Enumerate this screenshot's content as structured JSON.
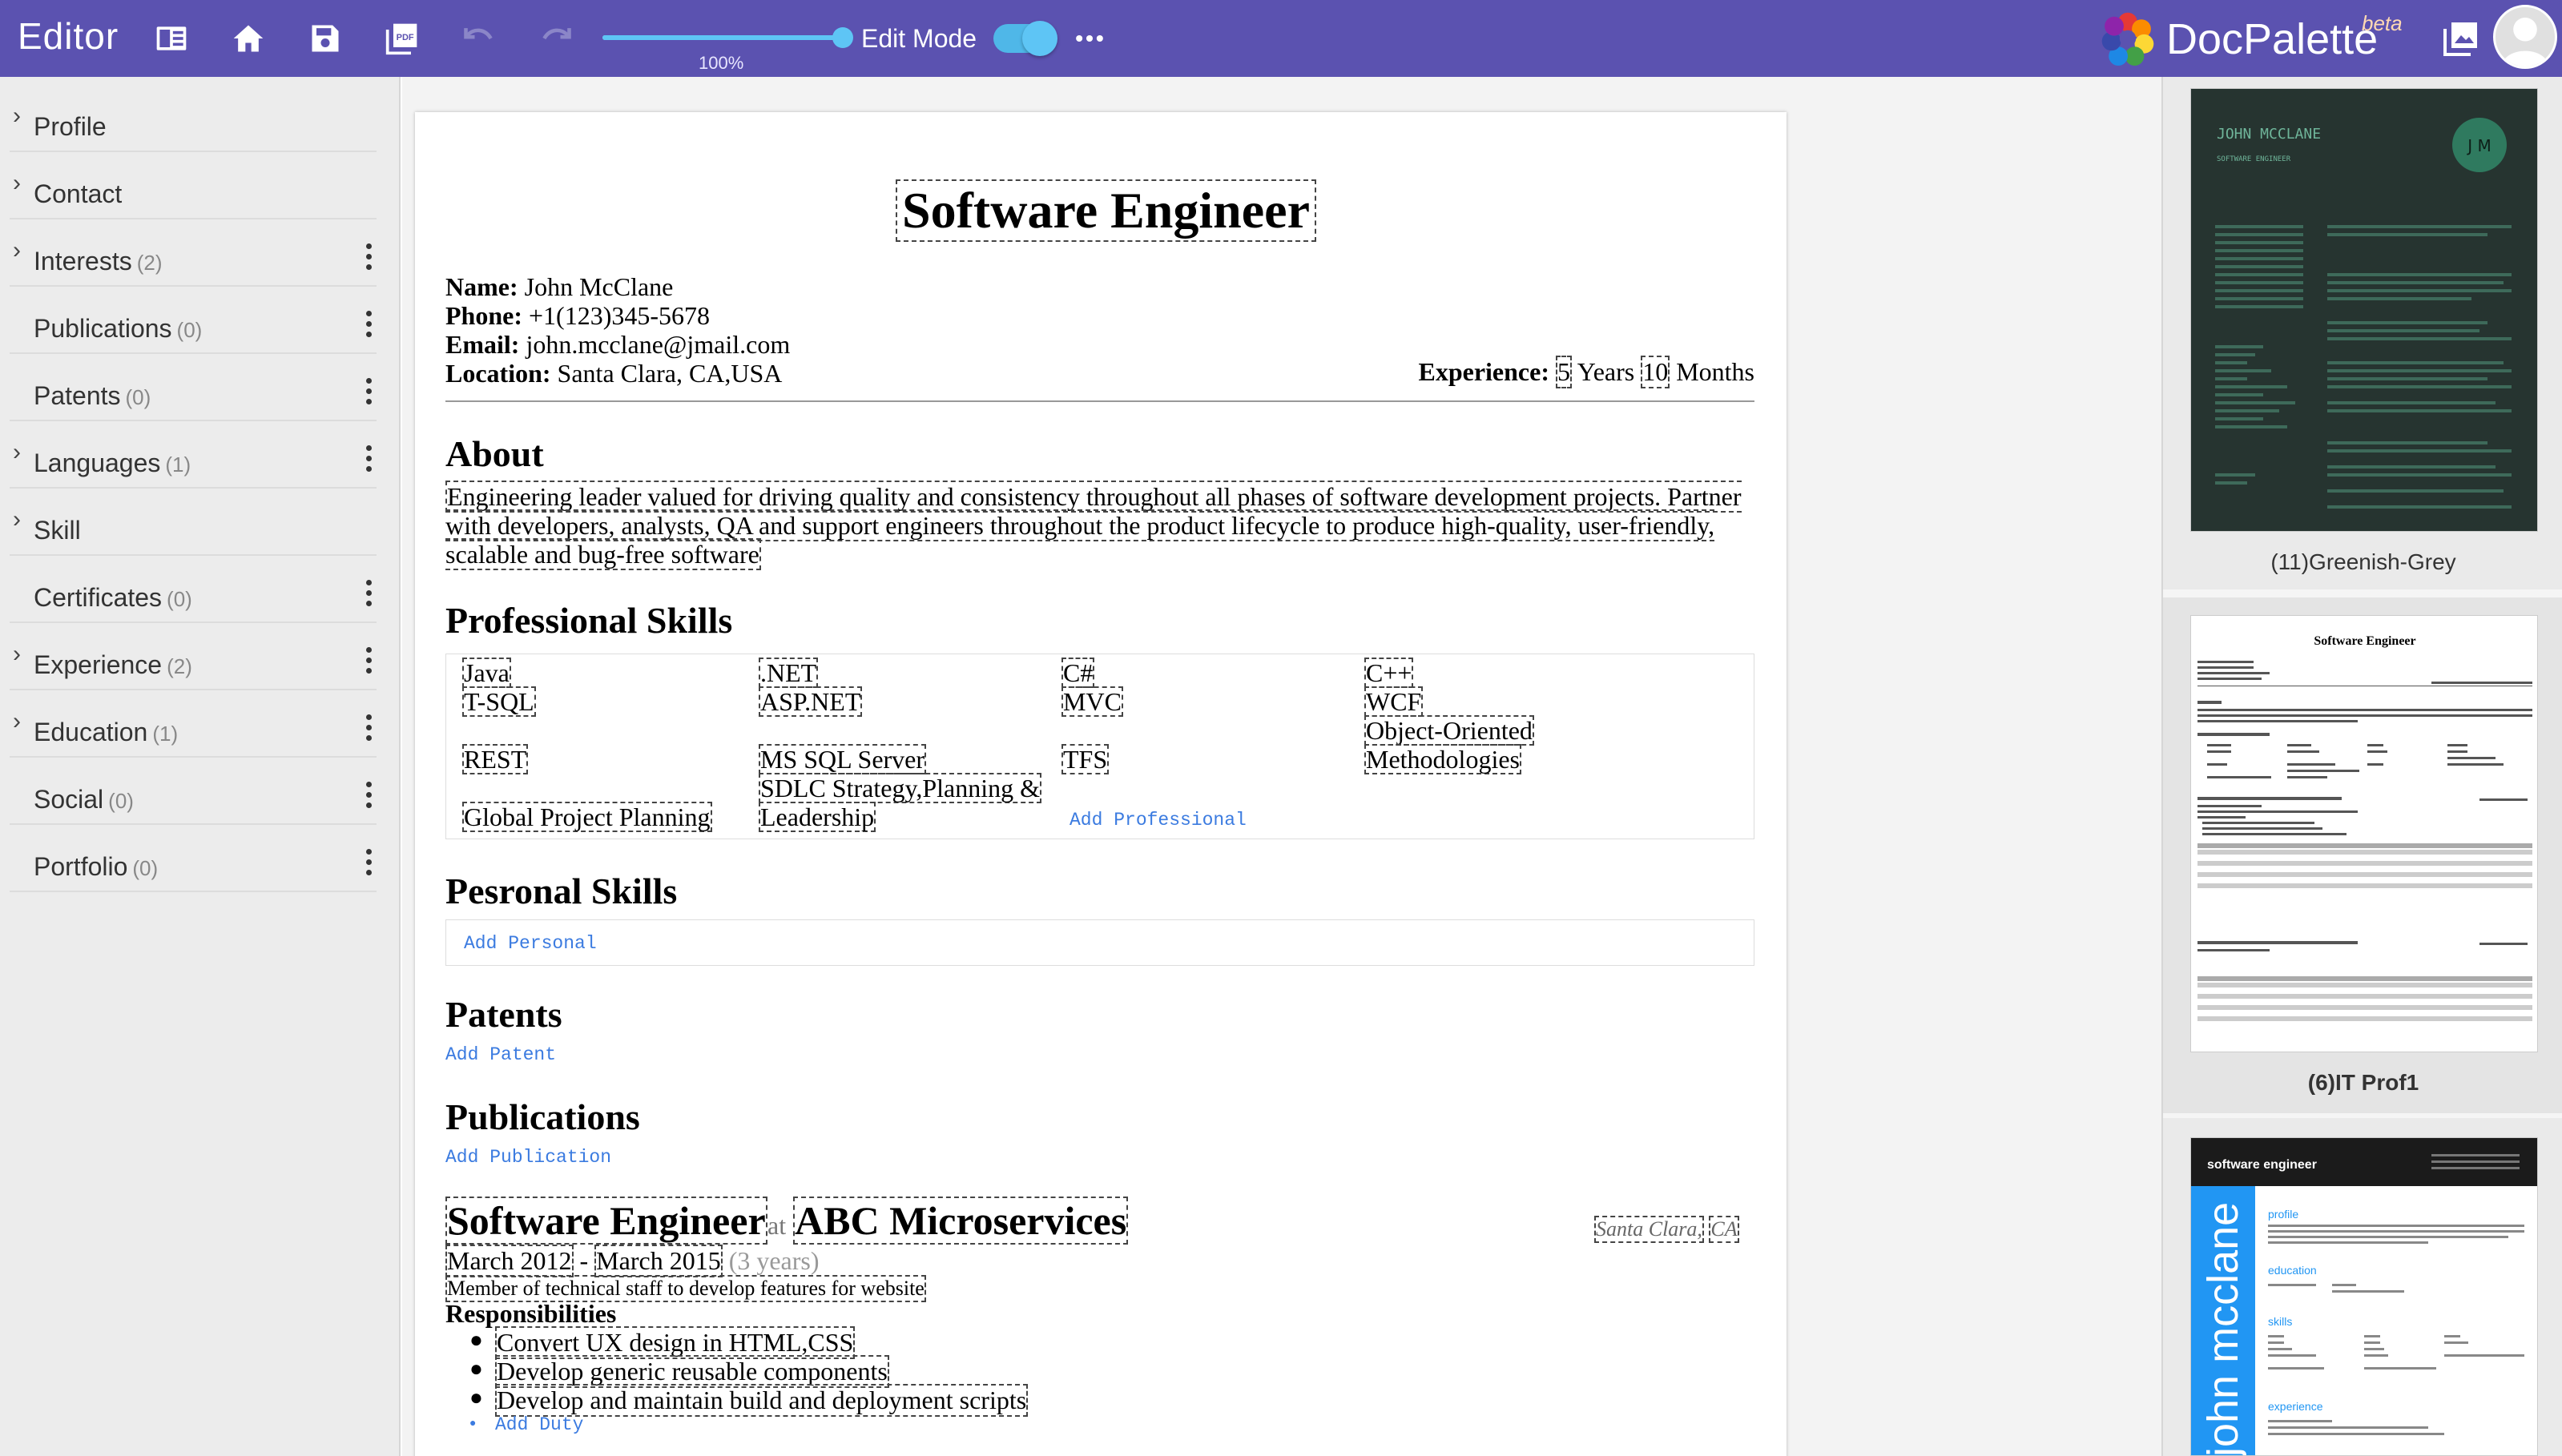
{
  "app": {
    "title": "Editor",
    "zoom_label": "100%",
    "zoom_value": 1.0,
    "edit_mode_label": "Edit Mode",
    "edit_mode_on": true,
    "brand_name": "DocPalette",
    "brand_beta": "beta",
    "accent_color": "#5b52b0",
    "toggle_color": "#5ec5f5",
    "toolbar_icons": [
      "sidebar-toggle-icon",
      "home-icon",
      "save-icon",
      "pdf-icon",
      "undo-icon",
      "redo-icon",
      "more-icon"
    ]
  },
  "sidebar": {
    "items": [
      {
        "label": "Profile",
        "count": "",
        "expandable": true,
        "menu": false
      },
      {
        "label": "Contact",
        "count": "",
        "expandable": true,
        "menu": false
      },
      {
        "label": "Interests",
        "count": "(2)",
        "expandable": true,
        "menu": true
      },
      {
        "label": "Publications",
        "count": "(0)",
        "expandable": false,
        "menu": true
      },
      {
        "label": "Patents",
        "count": "(0)",
        "expandable": false,
        "menu": true
      },
      {
        "label": "Languages",
        "count": "(1)",
        "expandable": true,
        "menu": true
      },
      {
        "label": "Skill",
        "count": "",
        "expandable": true,
        "menu": false
      },
      {
        "label": "Certificates",
        "count": "(0)",
        "expandable": false,
        "menu": true
      },
      {
        "label": "Experience",
        "count": "(2)",
        "expandable": true,
        "menu": true
      },
      {
        "label": "Education",
        "count": "(1)",
        "expandable": true,
        "menu": true
      },
      {
        "label": "Social",
        "count": "(0)",
        "expandable": false,
        "menu": true
      },
      {
        "label": "Portfolio",
        "count": "(0)",
        "expandable": false,
        "menu": true
      }
    ]
  },
  "doc": {
    "title": "Software Engineer",
    "name_label": "Name:",
    "name": "John McClane",
    "phone_label": "Phone:",
    "phone": "+1(123)345-5678",
    "email_label": "Email:",
    "email": "john.mcclane@jmail.com",
    "location_label": "Location:",
    "location": "Santa Clara, CA,USA",
    "experience_label": "Experience:",
    "exp_years": "5",
    "years_word": "Years",
    "exp_months": "10",
    "months_word": "Months",
    "about_heading": "About",
    "about_text": "Engineering leader valued for driving quality and consistency throughout all phases of software development projects. Partner with developers, analysts, QA and support engineers throughout the product lifecycle to produce high-quality, user-friendly, scalable and bug-free software",
    "pro_skills_heading": "Professional Skills",
    "skills": {
      "col1": [
        "Java",
        "T-SQL",
        "REST",
        "Global Project Planning"
      ],
      "col2": [
        ".NET",
        "ASP.NET",
        "MS SQL Server",
        "SDLC Strategy,Planning &",
        "Leadership"
      ],
      "col3": [
        "C#",
        "MVC",
        "TFS"
      ],
      "col4": [
        "C++",
        "WCF",
        "Object-Oriented",
        "Methodologies"
      ]
    },
    "add_professional": "Add Professional",
    "personal_heading": "Pesronal Skills",
    "add_personal": "Add Personal",
    "patents_heading": "Patents",
    "add_patent": "Add Patent",
    "publications_heading": "Publications",
    "add_publication": "Add Publication",
    "job": {
      "title": "Software Engineer",
      "at": "at",
      "company": "ABC Microservices",
      "city": "Santa Clara,",
      "state": "CA",
      "start": "March 2012",
      "sep": "-",
      "end": "March 2015",
      "duration": "(3 years)",
      "description": "Member of technical staff to develop features for website",
      "resp_heading": "Responsibilities",
      "duties": [
        "Convert UX design in HTML,CSS",
        "Develop generic reusable components",
        "Develop and maintain build and deployment scripts"
      ],
      "add_duty": "Add Duty"
    }
  },
  "templates": [
    {
      "label": "(11)Greenish-Grey",
      "name": "JOHN MCCLANE",
      "subtitle": "SOFTWARE ENGINEER",
      "initials": "J M"
    },
    {
      "label": "(6)IT Prof1",
      "title": "Software Engineer"
    },
    {
      "label": "",
      "header": "software engineer",
      "name": "john mcclane",
      "sections": [
        "profile",
        "education",
        "skills",
        "experience"
      ]
    }
  ]
}
